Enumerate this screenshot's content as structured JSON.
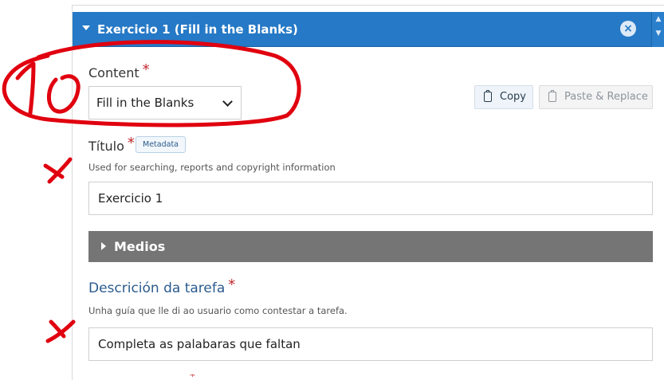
{
  "panel": {
    "title": "Exercicio 1 (Fill in the Blanks)",
    "remove_icon": "close-circle-icon",
    "order_icons": [
      "chevron-up-icon",
      "chevron-down-icon"
    ]
  },
  "content": {
    "label": "Content",
    "required": "*",
    "selected": "Fill in the Blanks"
  },
  "buttons": {
    "copy": "Copy",
    "paste": "Paste & Replace"
  },
  "titulo": {
    "label": "Título",
    "required": "*",
    "badge": "Metadata",
    "help": "Used for searching, reports and copyright information",
    "value": "Exercicio 1"
  },
  "medios": {
    "label": "Medios"
  },
  "descricion": {
    "label": "Descrición da tarefa",
    "required": "*",
    "help": "Unha guía que lle di ao usuario como contestar a tarefa.",
    "value": "Completa as palabaras que faltan"
  },
  "colors": {
    "header_blue": "#2579c6",
    "medios_gray": "#757575",
    "required_red": "#c0272d",
    "annotation_red": "#e0000f"
  },
  "annotations": {
    "handwritten_number": "10"
  }
}
